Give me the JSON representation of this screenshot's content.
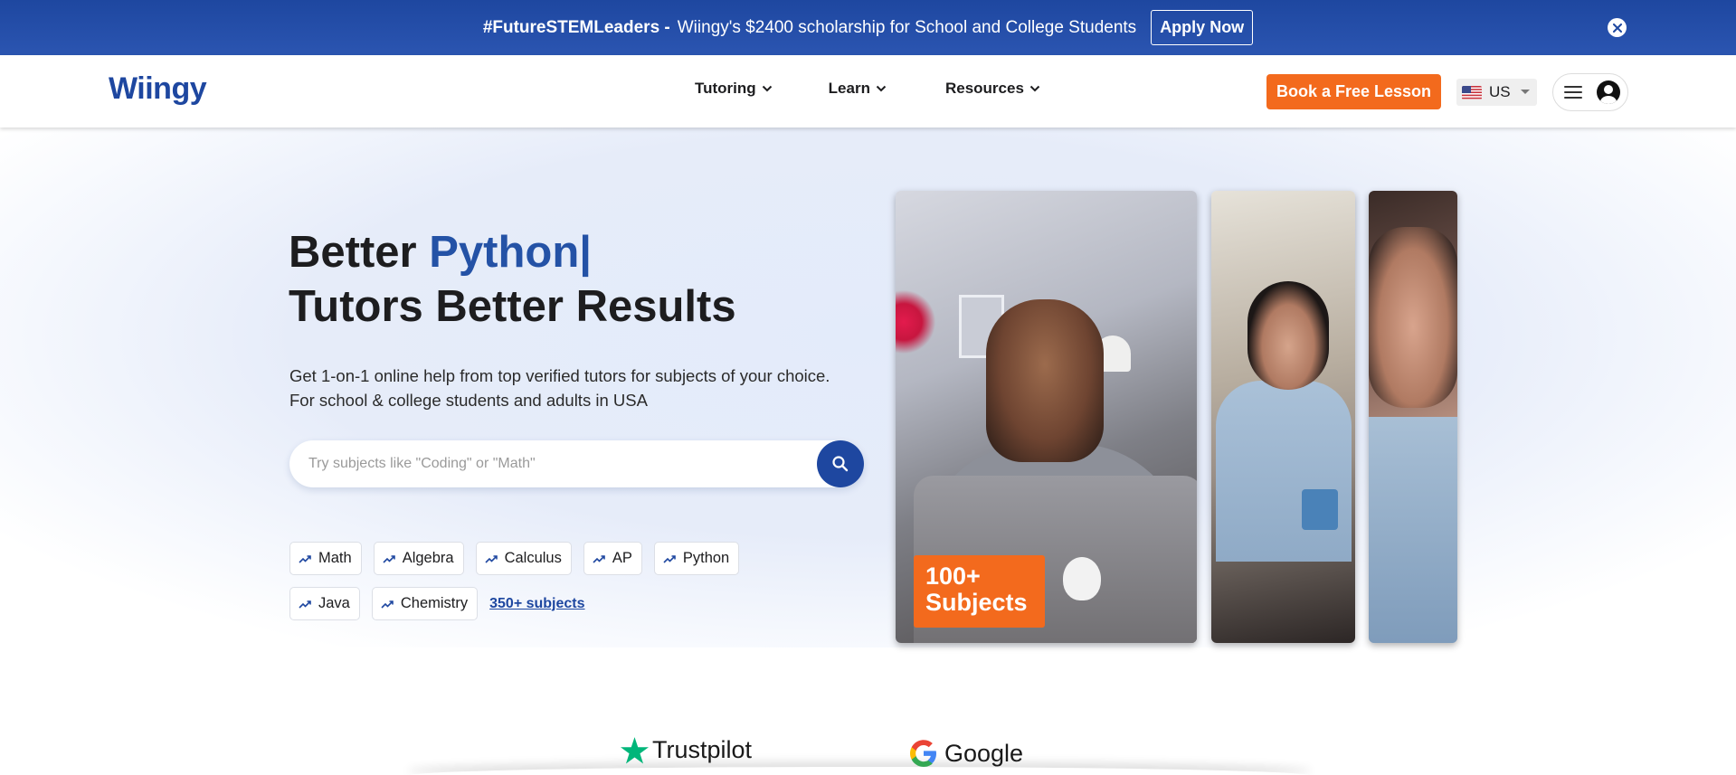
{
  "promo": {
    "hashtag": "#FutureSTEMLeaders -",
    "message": "Wiingy's $2400 scholarship for School and College Students",
    "apply_label": "Apply Now"
  },
  "header": {
    "logo": "Wiingy",
    "nav": [
      {
        "label": "Tutoring"
      },
      {
        "label": "Learn"
      },
      {
        "label": "Resources"
      }
    ],
    "book_label": "Book a Free Lesson",
    "country": "US"
  },
  "hero": {
    "title_prefix": "Better ",
    "title_accent": "Python|",
    "title_line2": "Tutors Better Results",
    "subtitle_line1": "Get 1-on-1 online help from top verified tutors for subjects of your choice.",
    "subtitle_line2": "For school & college students and adults in USA",
    "search_placeholder": "Try subjects like \"Coding\" or \"Math\"",
    "chips": [
      "Math",
      "Algebra",
      "Calculus",
      "AP",
      "Python",
      "Java",
      "Chemistry"
    ],
    "more_link": "350+ subjects",
    "badge_line1": "100+",
    "badge_line2": "Subjects"
  },
  "ratings": {
    "trustpilot": "Trustpilot",
    "google": "Google"
  },
  "colors": {
    "brand_blue": "#1e47a0",
    "accent_orange": "#f36a1d",
    "title_accent": "#2452a6"
  }
}
